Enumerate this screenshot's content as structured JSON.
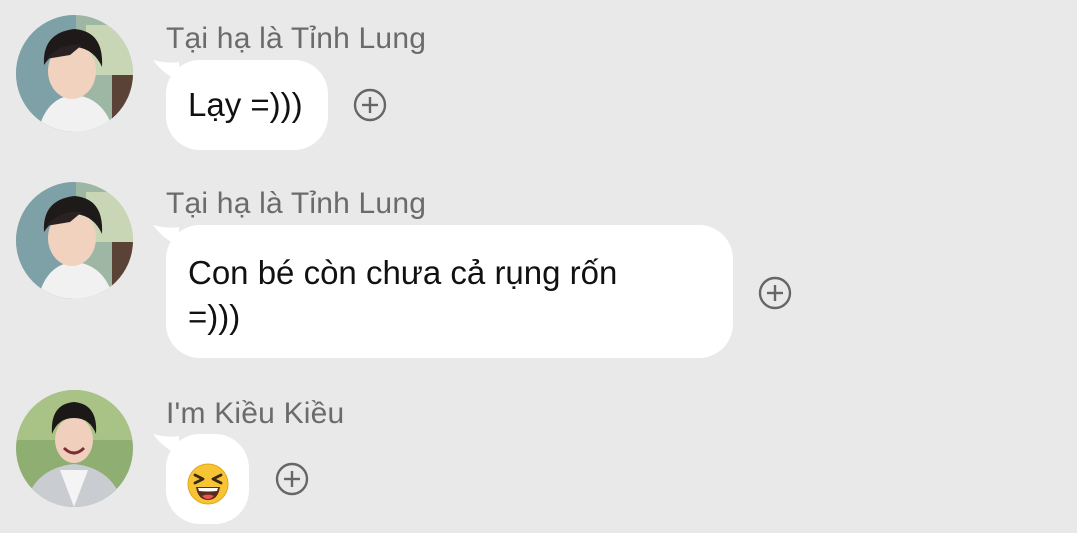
{
  "messages": [
    {
      "sender": "Tại hạ là Tỉnh Lung",
      "lines": [
        "Lạy =)))"
      ],
      "avatar_icon": "profile-photo-avatar"
    },
    {
      "sender": "Tại hạ là Tỉnh Lung",
      "lines": [
        "Con bé còn chưa cả rụng rốn",
        "=)))"
      ],
      "avatar_icon": "profile-photo-avatar"
    },
    {
      "sender": "I'm Kiều Kiều",
      "emoji": "grinning-squinting-face-emoji",
      "avatar_icon": "profile-photo-avatar"
    }
  ],
  "icons": {
    "reaction": "add-reaction-icon"
  },
  "colors": {
    "background": "#e9e9e9",
    "bubble": "#ffffff",
    "sender_text": "#6b6b6b",
    "message_text": "#111111",
    "icon_stroke": "#666666",
    "emoji_yellow": "#f7c433"
  }
}
